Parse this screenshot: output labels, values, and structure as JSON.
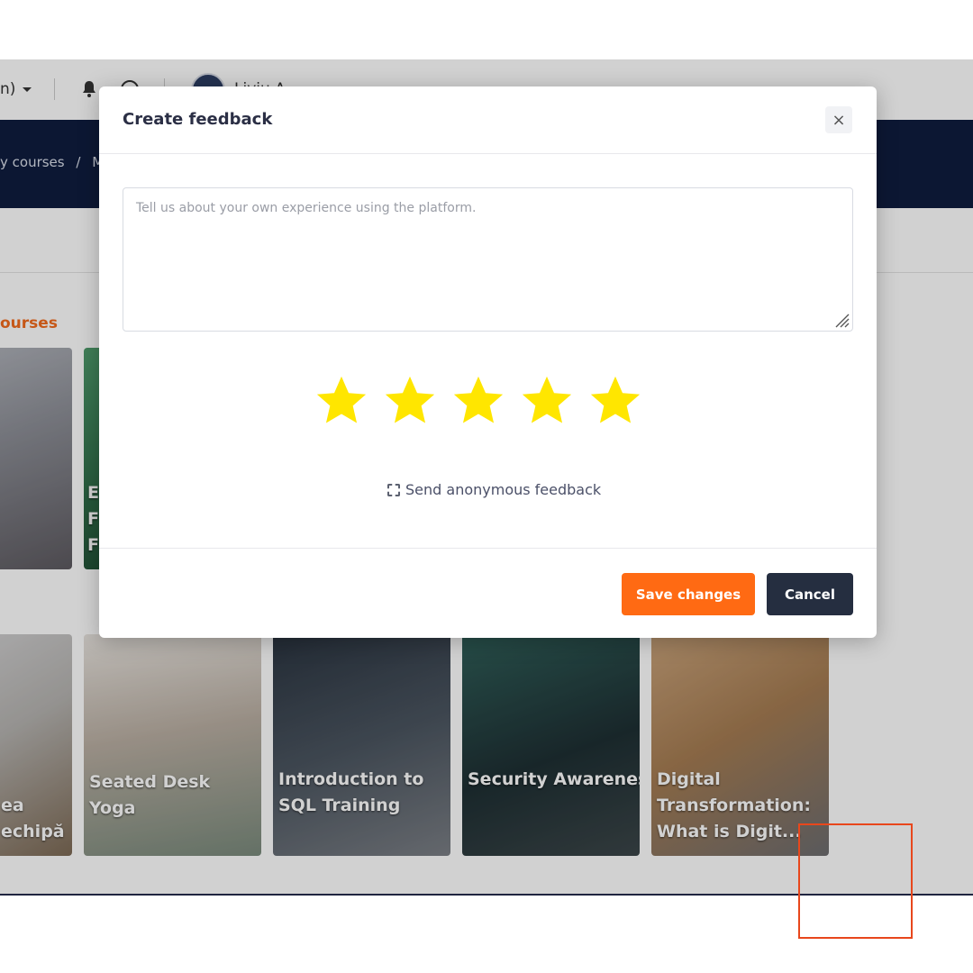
{
  "header": {
    "language_label": "n)",
    "username": "Liviu A"
  },
  "breadcrumb": {
    "items": [
      "y courses",
      "/",
      "Mo"
    ]
  },
  "section": {
    "title": "ourses"
  },
  "courses": [
    {
      "title": ""
    },
    {
      "title": "E\nF\nF"
    },
    {
      "title": "ea\nechipă"
    },
    {
      "title": "Seated Desk Yoga"
    },
    {
      "title": "Introduction to SQL Training"
    },
    {
      "title": "Security Awareness"
    },
    {
      "title": "Digital Transformation: What is Digit..."
    }
  ],
  "modal": {
    "title": "Create feedback",
    "close_symbol": "×",
    "textarea_placeholder": "Tell us about your own experience using the platform.",
    "rating": 5,
    "rating_max": 5,
    "star_color": "#ffe600",
    "anonymous_label": "Send anonymous feedback",
    "anonymous_checked": false,
    "save_label": "Save changes",
    "cancel_label": "Cancel"
  },
  "colors": {
    "accent": "#ff6a13",
    "navy": "#0f1d3f",
    "cancel_bg": "#252e40",
    "section_title": "#f26b1d"
  }
}
